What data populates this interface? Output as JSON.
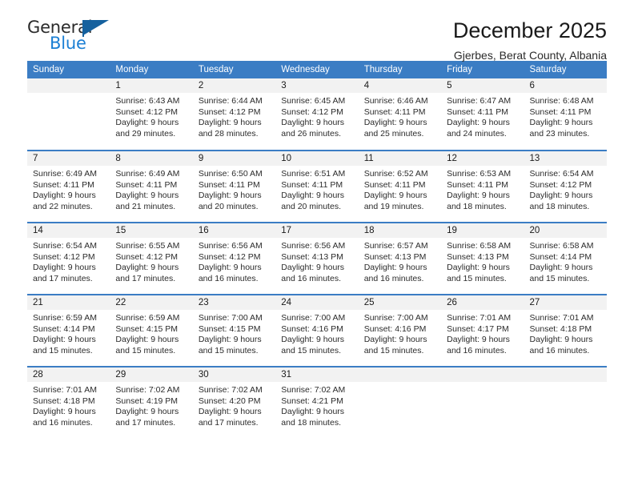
{
  "brand": {
    "word_one": "General",
    "word_two": "Blue",
    "flag_icon": "triangle-flag-icon",
    "blue": "#1b7fd4",
    "dark_blue": "#15619e"
  },
  "header": {
    "month_title": "December 2025",
    "location": "Gjerbes, Berat County, Albania"
  },
  "theme": {
    "header_bar": "#3b7dc4",
    "daynum_band": "#f2f2f2",
    "text": "#2b2b2b"
  },
  "weekday_headers": [
    "Sunday",
    "Monday",
    "Tuesday",
    "Wednesday",
    "Thursday",
    "Friday",
    "Saturday"
  ],
  "weeks": [
    [
      {
        "day": "",
        "lines": []
      },
      {
        "day": "1",
        "lines": [
          "Sunrise: 6:43 AM",
          "Sunset: 4:12 PM",
          "Daylight: 9 hours",
          "and 29 minutes."
        ]
      },
      {
        "day": "2",
        "lines": [
          "Sunrise: 6:44 AM",
          "Sunset: 4:12 PM",
          "Daylight: 9 hours",
          "and 28 minutes."
        ]
      },
      {
        "day": "3",
        "lines": [
          "Sunrise: 6:45 AM",
          "Sunset: 4:12 PM",
          "Daylight: 9 hours",
          "and 26 minutes."
        ]
      },
      {
        "day": "4",
        "lines": [
          "Sunrise: 6:46 AM",
          "Sunset: 4:11 PM",
          "Daylight: 9 hours",
          "and 25 minutes."
        ]
      },
      {
        "day": "5",
        "lines": [
          "Sunrise: 6:47 AM",
          "Sunset: 4:11 PM",
          "Daylight: 9 hours",
          "and 24 minutes."
        ]
      },
      {
        "day": "6",
        "lines": [
          "Sunrise: 6:48 AM",
          "Sunset: 4:11 PM",
          "Daylight: 9 hours",
          "and 23 minutes."
        ]
      }
    ],
    [
      {
        "day": "7",
        "lines": [
          "Sunrise: 6:49 AM",
          "Sunset: 4:11 PM",
          "Daylight: 9 hours",
          "and 22 minutes."
        ]
      },
      {
        "day": "8",
        "lines": [
          "Sunrise: 6:49 AM",
          "Sunset: 4:11 PM",
          "Daylight: 9 hours",
          "and 21 minutes."
        ]
      },
      {
        "day": "9",
        "lines": [
          "Sunrise: 6:50 AM",
          "Sunset: 4:11 PM",
          "Daylight: 9 hours",
          "and 20 minutes."
        ]
      },
      {
        "day": "10",
        "lines": [
          "Sunrise: 6:51 AM",
          "Sunset: 4:11 PM",
          "Daylight: 9 hours",
          "and 20 minutes."
        ]
      },
      {
        "day": "11",
        "lines": [
          "Sunrise: 6:52 AM",
          "Sunset: 4:11 PM",
          "Daylight: 9 hours",
          "and 19 minutes."
        ]
      },
      {
        "day": "12",
        "lines": [
          "Sunrise: 6:53 AM",
          "Sunset: 4:11 PM",
          "Daylight: 9 hours",
          "and 18 minutes."
        ]
      },
      {
        "day": "13",
        "lines": [
          "Sunrise: 6:54 AM",
          "Sunset: 4:12 PM",
          "Daylight: 9 hours",
          "and 18 minutes."
        ]
      }
    ],
    [
      {
        "day": "14",
        "lines": [
          "Sunrise: 6:54 AM",
          "Sunset: 4:12 PM",
          "Daylight: 9 hours",
          "and 17 minutes."
        ]
      },
      {
        "day": "15",
        "lines": [
          "Sunrise: 6:55 AM",
          "Sunset: 4:12 PM",
          "Daylight: 9 hours",
          "and 17 minutes."
        ]
      },
      {
        "day": "16",
        "lines": [
          "Sunrise: 6:56 AM",
          "Sunset: 4:12 PM",
          "Daylight: 9 hours",
          "and 16 minutes."
        ]
      },
      {
        "day": "17",
        "lines": [
          "Sunrise: 6:56 AM",
          "Sunset: 4:13 PM",
          "Daylight: 9 hours",
          "and 16 minutes."
        ]
      },
      {
        "day": "18",
        "lines": [
          "Sunrise: 6:57 AM",
          "Sunset: 4:13 PM",
          "Daylight: 9 hours",
          "and 16 minutes."
        ]
      },
      {
        "day": "19",
        "lines": [
          "Sunrise: 6:58 AM",
          "Sunset: 4:13 PM",
          "Daylight: 9 hours",
          "and 15 minutes."
        ]
      },
      {
        "day": "20",
        "lines": [
          "Sunrise: 6:58 AM",
          "Sunset: 4:14 PM",
          "Daylight: 9 hours",
          "and 15 minutes."
        ]
      }
    ],
    [
      {
        "day": "21",
        "lines": [
          "Sunrise: 6:59 AM",
          "Sunset: 4:14 PM",
          "Daylight: 9 hours",
          "and 15 minutes."
        ]
      },
      {
        "day": "22",
        "lines": [
          "Sunrise: 6:59 AM",
          "Sunset: 4:15 PM",
          "Daylight: 9 hours",
          "and 15 minutes."
        ]
      },
      {
        "day": "23",
        "lines": [
          "Sunrise: 7:00 AM",
          "Sunset: 4:15 PM",
          "Daylight: 9 hours",
          "and 15 minutes."
        ]
      },
      {
        "day": "24",
        "lines": [
          "Sunrise: 7:00 AM",
          "Sunset: 4:16 PM",
          "Daylight: 9 hours",
          "and 15 minutes."
        ]
      },
      {
        "day": "25",
        "lines": [
          "Sunrise: 7:00 AM",
          "Sunset: 4:16 PM",
          "Daylight: 9 hours",
          "and 15 minutes."
        ]
      },
      {
        "day": "26",
        "lines": [
          "Sunrise: 7:01 AM",
          "Sunset: 4:17 PM",
          "Daylight: 9 hours",
          "and 16 minutes."
        ]
      },
      {
        "day": "27",
        "lines": [
          "Sunrise: 7:01 AM",
          "Sunset: 4:18 PM",
          "Daylight: 9 hours",
          "and 16 minutes."
        ]
      }
    ],
    [
      {
        "day": "28",
        "lines": [
          "Sunrise: 7:01 AM",
          "Sunset: 4:18 PM",
          "Daylight: 9 hours",
          "and 16 minutes."
        ]
      },
      {
        "day": "29",
        "lines": [
          "Sunrise: 7:02 AM",
          "Sunset: 4:19 PM",
          "Daylight: 9 hours",
          "and 17 minutes."
        ]
      },
      {
        "day": "30",
        "lines": [
          "Sunrise: 7:02 AM",
          "Sunset: 4:20 PM",
          "Daylight: 9 hours",
          "and 17 minutes."
        ]
      },
      {
        "day": "31",
        "lines": [
          "Sunrise: 7:02 AM",
          "Sunset: 4:21 PM",
          "Daylight: 9 hours",
          "and 18 minutes."
        ]
      },
      {
        "day": "",
        "lines": []
      },
      {
        "day": "",
        "lines": []
      },
      {
        "day": "",
        "lines": []
      }
    ]
  ]
}
